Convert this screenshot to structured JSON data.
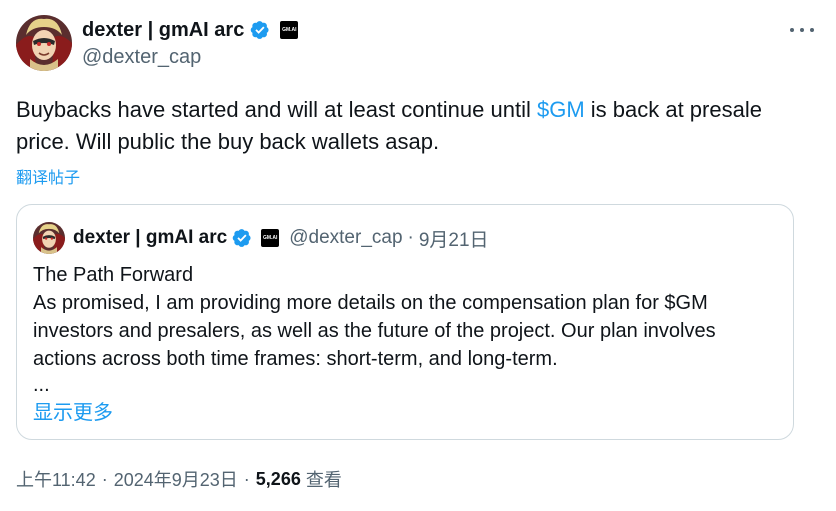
{
  "author": {
    "display_name": "dexter | gmAI arc",
    "handle": "@dexter_cap",
    "affiliate_badge_text": "GM.AI",
    "avatar_icon": "anime-character-avatar",
    "verified_icon": "verified-badge-icon"
  },
  "tweet": {
    "text_before_cashtag": "Buybacks have started and will at least continue until ",
    "cashtag": "$GM",
    "text_after_cashtag": " is back at presale price. Will public the buy back wallets asap.",
    "translate_label": "翻译帖子"
  },
  "quoted_tweet": {
    "display_name": "dexter | gmAI arc",
    "handle": "@dexter_cap",
    "separator": "·",
    "date": "9月21日",
    "affiliate_badge_text": "GM.AI",
    "title": "The Path Forward",
    "body": "As promised, I am providing more details on the compensation plan for $GM investors and presalers, as well as the future of the project. Our plan involves actions across both time frames: short-term, and long-term.",
    "ellipsis": "...",
    "show_more_label": "显示更多"
  },
  "meta": {
    "time": "上午11:42",
    "separator": "·",
    "date": "2024年9月23日",
    "views_count": "5,266",
    "views_label": "查看"
  },
  "colors": {
    "accent": "#1d9bf0",
    "text_primary": "#0f1419",
    "text_secondary": "#536471",
    "border": "#cfd9de"
  }
}
